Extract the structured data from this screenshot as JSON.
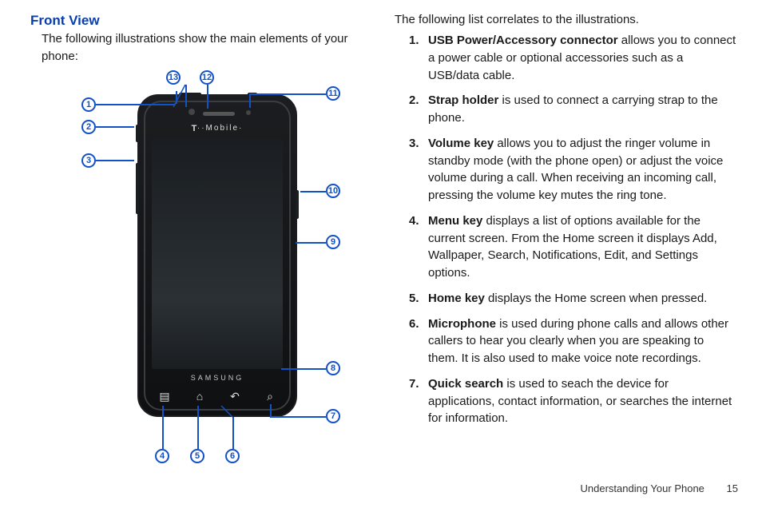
{
  "heading": "Front View",
  "leftIntro": "The following illustrations show the main elements of your phone:",
  "rightIntro": "The following list correlates to the illustrations.",
  "phone": {
    "carrierLabel": "··Mobile·",
    "carrierPrefix": "T",
    "brand": "SAMSUNG",
    "navGlyphs": {
      "menu": "▤",
      "home": "⌂",
      "back": "↶",
      "search": "⌕"
    }
  },
  "callouts": {
    "c1": "1",
    "c2": "2",
    "c3": "3",
    "c4": "4",
    "c5": "5",
    "c6": "6",
    "c7": "7",
    "c8": "8",
    "c9": "9",
    "c10": "10",
    "c11": "11",
    "c12": "12",
    "c13": "13"
  },
  "items": [
    {
      "num": "1.",
      "term": "USB Power/Accessory connector",
      "text": " allows you to connect a power cable or optional accessories such as a USB/data cable."
    },
    {
      "num": "2.",
      "term": "Strap holder",
      "text": " is used to connect a carrying strap to the phone."
    },
    {
      "num": "3.",
      "term": "Volume key",
      "text": " allows you to adjust the ringer volume in standby mode (with the phone open) or adjust the voice volume during a call. When receiving an incoming call, pressing the volume key mutes the ring tone."
    },
    {
      "num": "4.",
      "term": "Menu key",
      "text": " displays a list of options available for the current screen. From the Home screen it displays Add, Wallpaper, Search, Notifications, Edit, and Settings options."
    },
    {
      "num": "5.",
      "term": "Home key",
      "text": " displays the Home screen when pressed."
    },
    {
      "num": "6.",
      "term": "Microphone",
      "text": " is used during phone calls and allows other callers to hear you clearly when you are speaking to them. It is also used to make voice note recordings."
    },
    {
      "num": "7.",
      "term": "Quick search",
      "text": " is used to seach the device for applications, contact information, or searches the internet for information."
    }
  ],
  "footer": {
    "section": "Understanding Your Phone",
    "page": "15"
  }
}
